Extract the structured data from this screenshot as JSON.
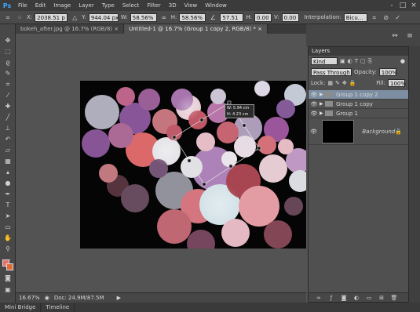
{
  "app": {
    "logo": "Ps"
  },
  "menu": [
    "File",
    "Edit",
    "Image",
    "Layer",
    "Type",
    "Select",
    "Filter",
    "3D",
    "View",
    "Window"
  ],
  "window_controls": {
    "minimize": "-",
    "restore": "□",
    "close": "×"
  },
  "options_bar": {
    "x_label": "X:",
    "x_value": "2038.51 p",
    "y_label": "Y:",
    "y_value": "944.04 px",
    "w_label": "W:",
    "w_value": "58.56%",
    "h_label": "H:",
    "h_value": "58.56%",
    "angle_value": "57.51",
    "hskew_label": "H:",
    "hskew_value": "0.00",
    "vskew_label": "V:",
    "vskew_value": "0.00",
    "interp_label": "Interpolation:",
    "interp_value": "Bicu..."
  },
  "doc_tabs": [
    {
      "label": "bokeh_after.jpg @ 16.7% (RGB/8) ×",
      "active": false
    },
    {
      "label": "Untitled-1 @ 16.7% (Group 1 copy 2, RGB/8) * ×",
      "active": true
    }
  ],
  "transform_tooltip": {
    "w": "W: 5.94 cm",
    "h": "H: 4.23 cm"
  },
  "status": {
    "zoom": "16.67%",
    "doc": "Doc: 24.9M/87.5M"
  },
  "bottom_tabs": [
    "Mini Bridge",
    "Timeline"
  ],
  "layers_panel": {
    "title": "Layers",
    "filter_value": "Kind",
    "blend_mode": "Pass Through",
    "opacity_label": "Opacity:",
    "opacity_value": "100%",
    "lock_label": "Lock:",
    "fill_label": "Fill:",
    "fill_value": "100%",
    "layers": [
      {
        "name": "Group 1 copy 2",
        "type": "group",
        "selected": true
      },
      {
        "name": "Group 1 copy",
        "type": "group",
        "selected": false
      },
      {
        "name": "Group 1",
        "type": "group",
        "selected": false
      },
      {
        "name": "Background",
        "type": "image",
        "selected": false
      }
    ]
  },
  "colors": {
    "foreground": "#e8706a",
    "background": "#e06a33",
    "selection": "#7d8ea3"
  },
  "tool_icons": [
    "move-icon",
    "marquee-icon",
    "lasso-icon",
    "quick-select-icon",
    "crop-icon",
    "eyedropper-icon",
    "healing-icon",
    "brush-icon",
    "clone-stamp-icon",
    "history-brush-icon",
    "eraser-icon",
    "gradient-icon",
    "blur-icon",
    "dodge-icon",
    "pen-icon",
    "type-icon",
    "path-select-icon",
    "shape-icon",
    "hand-icon",
    "zoom-icon"
  ],
  "bokeh_circles": [
    {
      "c": "#b7b7c8",
      "o": 0.9
    }
  ]
}
